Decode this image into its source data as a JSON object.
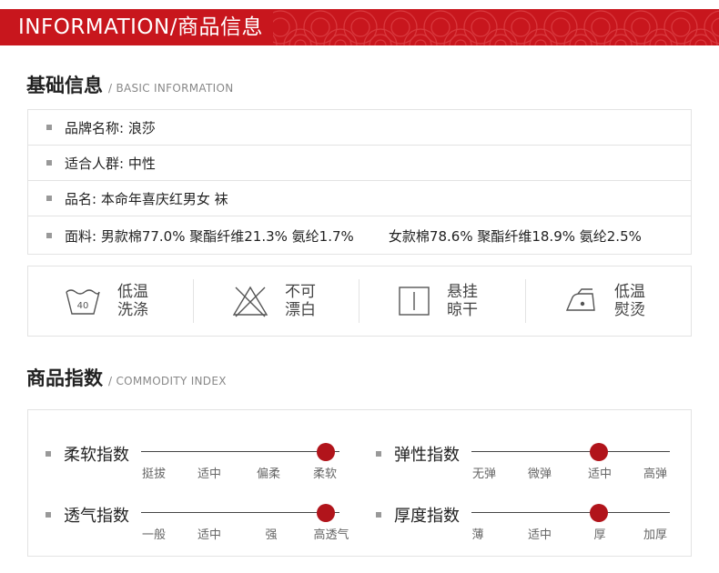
{
  "banner": {
    "title": "INFORMATION/商品信息"
  },
  "basic": {
    "title": "基础信息",
    "subtitle": "/ BASIC INFORMATION",
    "rows": [
      "品牌名称: 浪莎",
      "适合人群: 中性",
      "品名: 本命年喜庆红男女 袜",
      "面料: 男款棉77.0% 聚酯纤维21.3% 氨纶1.7%        女款棉78.6% 聚酯纤维18.9% 氨纶2.5%"
    ]
  },
  "care": [
    {
      "icon": "wash-40-icon",
      "line1": "低温",
      "line2": "洗涤",
      "badge": "40"
    },
    {
      "icon": "no-bleach-icon",
      "line1": "不可",
      "line2": "漂白"
    },
    {
      "icon": "hang-dry-icon",
      "line1": "悬挂",
      "line2": "晾干"
    },
    {
      "icon": "low-iron-icon",
      "line1": "低温",
      "line2": "熨烫"
    }
  ],
  "index": {
    "title": "商品指数",
    "subtitle": "/ COMMODITY  INDEX",
    "scales": [
      {
        "name": "柔软指数",
        "labels": [
          "挺拔",
          "适中",
          "偏柔",
          "柔软"
        ],
        "level": 3
      },
      {
        "name": "弹性指数",
        "labels": [
          "无弹",
          "微弹",
          "适中",
          "高弹"
        ],
        "level": 2
      },
      {
        "name": "透气指数",
        "labels": [
          "一般",
          "适中",
          "强",
          "高透气"
        ],
        "level": 3
      },
      {
        "name": "厚度指数",
        "labels": [
          "薄",
          "适中",
          "厚",
          "加厚"
        ],
        "level": 2
      }
    ]
  },
  "colors": {
    "brand_red": "#c8161d",
    "dot_red": "#b1141b"
  }
}
